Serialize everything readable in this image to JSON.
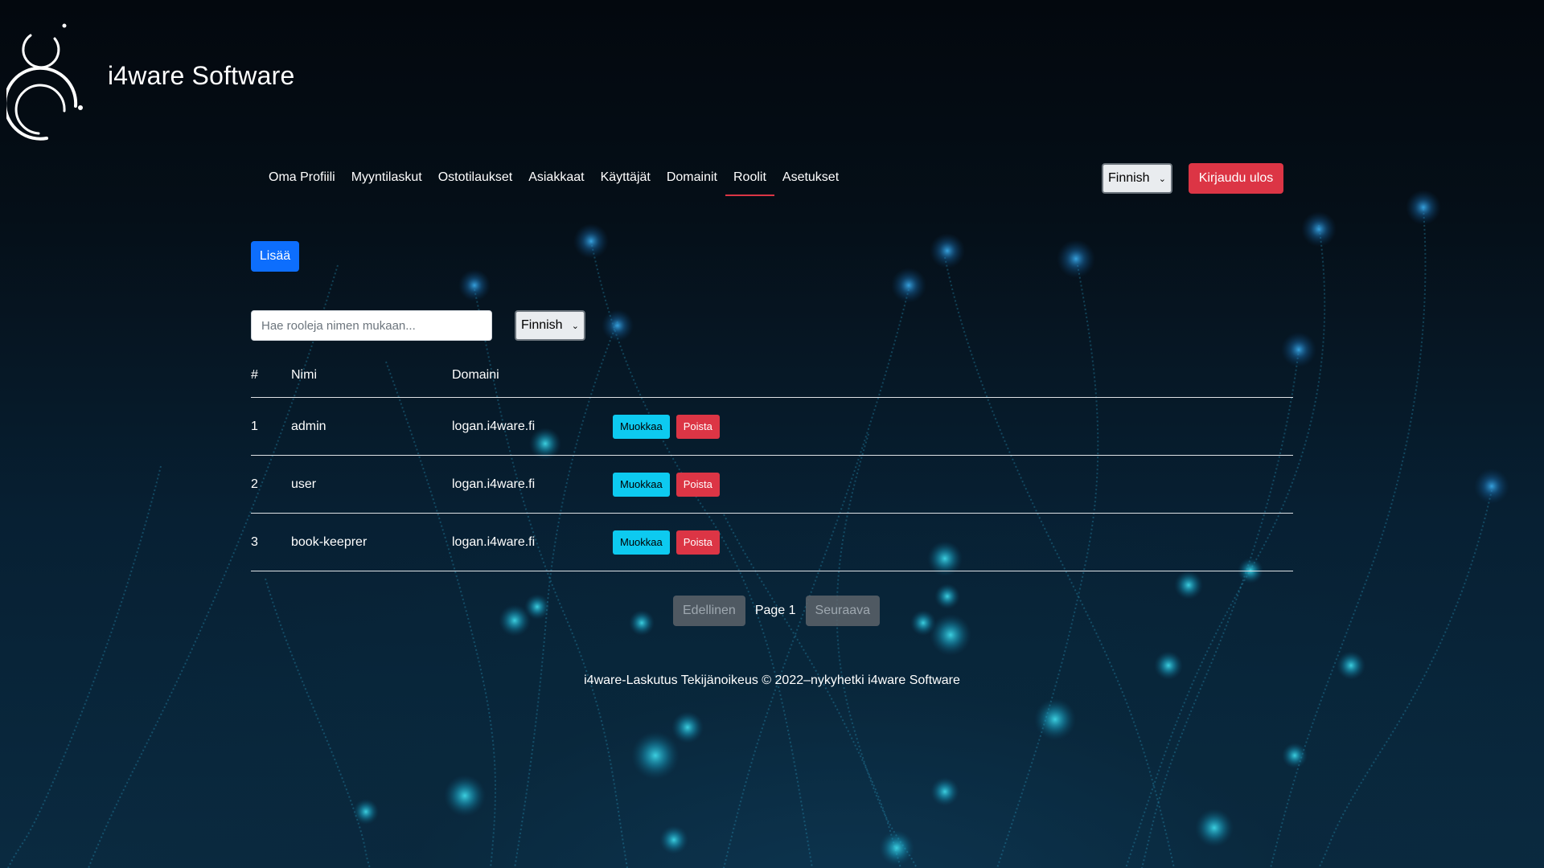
{
  "brand": {
    "name": "i4ware Software"
  },
  "nav": {
    "items": [
      {
        "label": "Oma Profiili",
        "active": false
      },
      {
        "label": "Myyntilaskut",
        "active": false
      },
      {
        "label": "Ostotilaukset",
        "active": false
      },
      {
        "label": "Asiakkaat",
        "active": false
      },
      {
        "label": "Käyttäjät",
        "active": false
      },
      {
        "label": "Domainit",
        "active": false
      },
      {
        "label": "Roolit",
        "active": true
      },
      {
        "label": "Asetukset",
        "active": false
      }
    ],
    "language_selected": "Finnish",
    "logout_label": "Kirjaudu ulos"
  },
  "toolbar": {
    "add_label": "Lisää",
    "search_placeholder": "Hae rooleja nimen mukaan...",
    "search_value": "",
    "language_selected": "Finnish"
  },
  "table": {
    "headers": {
      "num": "#",
      "name": "Nimi",
      "domain": "Domaini"
    },
    "edit_label": "Muokkaa",
    "delete_label": "Poista",
    "rows": [
      {
        "num": "1",
        "name": "admin",
        "domain": "logan.i4ware.fi"
      },
      {
        "num": "2",
        "name": "user",
        "domain": "logan.i4ware.fi"
      },
      {
        "num": "3",
        "name": "book-keeprer",
        "domain": "logan.i4ware.fi"
      }
    ]
  },
  "pagination": {
    "prev_label": "Edellinen",
    "page_label": "Page 1",
    "next_label": "Seuraava"
  },
  "footer": {
    "text": "i4ware-Laskutus Tekijänoikeus © 2022–nykyhetki i4ware Software"
  },
  "colors": {
    "danger": "#dc3545",
    "primary": "#0d6efd",
    "info": "#0dcaf0",
    "background": "#050f18"
  },
  "icons": {
    "logo": "i4ware-circle-logo",
    "select_arrow": "chevron-down-icon"
  }
}
